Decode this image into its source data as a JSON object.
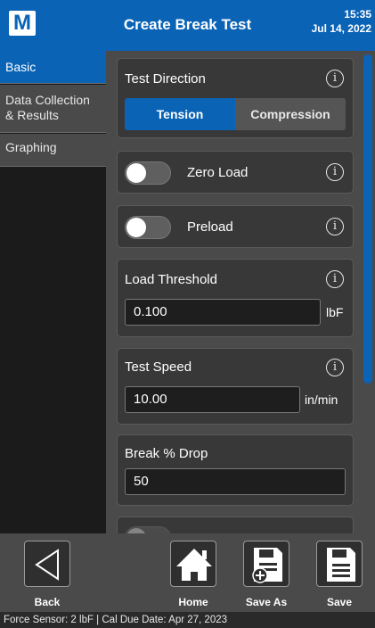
{
  "header": {
    "logo": "M",
    "title": "Create Break Test",
    "time": "15:35",
    "date": "Jul 14, 2022"
  },
  "sidebar": {
    "items": [
      {
        "label": "Basic"
      },
      {
        "label": "Data Collection\n& Results"
      },
      {
        "label": "Graphing"
      }
    ]
  },
  "cards": {
    "test_direction": {
      "label": "Test Direction",
      "options": [
        "Tension",
        "Compression"
      ],
      "selected": "Tension"
    },
    "zero_load": {
      "label": "Zero Load",
      "enabled": false
    },
    "preload": {
      "label": "Preload",
      "enabled": false
    },
    "load_threshold": {
      "label": "Load Threshold",
      "value": "0.100",
      "unit": "lbF"
    },
    "test_speed": {
      "label": "Test Speed",
      "value": "10.00",
      "unit": "in/min"
    },
    "break_drop": {
      "label": "Break % Drop",
      "value": "50"
    }
  },
  "info_glyph": "i",
  "toolbar": {
    "back": "Back",
    "home": "Home",
    "save_as": "Save As",
    "save": "Save"
  },
  "status": "Force Sensor: 2 lbF  |  Cal Due Date: Apr 27, 2023"
}
